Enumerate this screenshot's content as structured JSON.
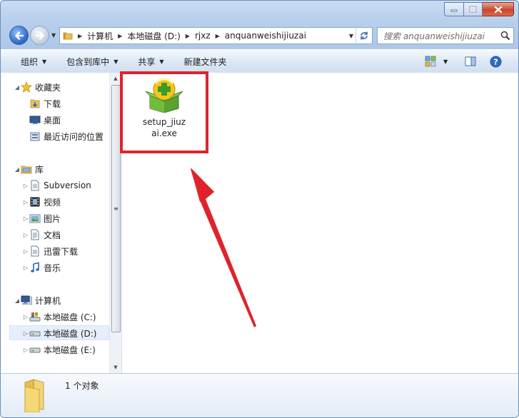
{
  "window": {
    "title": ""
  },
  "nav": {
    "breadcrumbs": [
      "计算机",
      "本地磁盘 (D:)",
      "rjxz",
      "anquanweishijiuzai"
    ]
  },
  "search": {
    "placeholder": "搜索 anquanweishijiuzai"
  },
  "toolbar": {
    "organize": "组织",
    "include_in_library": "包含到库中",
    "share": "共享",
    "new_folder": "新建文件夹"
  },
  "sidebar": {
    "favorites": {
      "label": "收藏夹",
      "items": [
        "下载",
        "桌面",
        "最近访问的位置"
      ]
    },
    "libraries": {
      "label": "库",
      "items": [
        "Subversion",
        "视频",
        "图片",
        "文档",
        "迅雷下载",
        "音乐"
      ]
    },
    "computer": {
      "label": "计算机",
      "items": [
        "本地磁盘 (C:)",
        "本地磁盘 (D:)",
        "本地磁盘 (E:)"
      ],
      "selected": "本地磁盘 (D:)"
    }
  },
  "content": {
    "files": [
      {
        "name_line1": "setup_jiuz",
        "name_line2": "ai.exe",
        "icon": "installer-icon"
      }
    ]
  },
  "status": {
    "item_count": "1 个对象"
  },
  "colors": {
    "annotation": "#e0232b",
    "accent": "#2a64c6"
  }
}
